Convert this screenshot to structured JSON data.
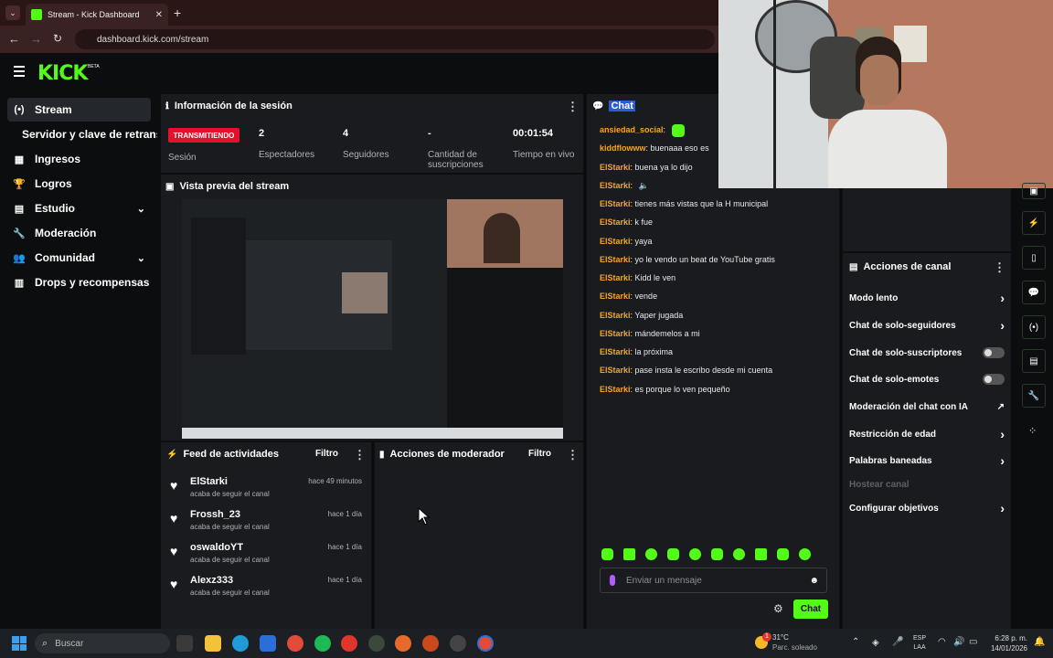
{
  "browser": {
    "tab_title": "Stream - Kick Dashboard",
    "url": "dashboard.kick.com/stream"
  },
  "brand": {
    "logo": "KICK",
    "beta": "BETA",
    "accent": "#53fc18"
  },
  "sidebar": {
    "items": [
      {
        "label": "Stream",
        "icon": "broadcast-icon"
      },
      {
        "label": "Servidor y clave de retransmisión",
        "icon": ""
      },
      {
        "label": "Ingresos",
        "icon": "chart-icon"
      },
      {
        "label": "Logros",
        "icon": "trophy-icon"
      },
      {
        "label": "Estudio",
        "icon": "grid-icon"
      },
      {
        "label": "Moderación",
        "icon": "wrench-icon"
      },
      {
        "label": "Comunidad",
        "icon": "people-icon"
      },
      {
        "label": "Drops y recompensas",
        "icon": "gift-icon"
      }
    ]
  },
  "session": {
    "title": "Información de la sesión",
    "badge": "TRANSMITIENDO",
    "badge_label": "Sesión",
    "stats": [
      {
        "value": "2",
        "label": "Espectadores"
      },
      {
        "value": "4",
        "label": "Seguidores"
      },
      {
        "value": "-",
        "label": "Cantidad de suscripciones"
      },
      {
        "value": "00:01:54",
        "label": "Tiempo en vivo"
      }
    ]
  },
  "preview": {
    "title": "Vista previa del stream"
  },
  "feed": {
    "title": "Feed de actividades",
    "filter": "Filtro",
    "items": [
      {
        "name": "ElStarki",
        "sub": "acaba de seguir el canal",
        "time": "hace 49 minutos"
      },
      {
        "name": "Frossh_23",
        "sub": "acaba de seguir el canal",
        "time": "hace 1 día"
      },
      {
        "name": "oswaldoYT",
        "sub": "acaba de seguir el canal",
        "time": "hace 1 día"
      },
      {
        "name": "Alexz333",
        "sub": "acaba de seguir el canal",
        "time": "hace 1 día"
      }
    ]
  },
  "mod_actions": {
    "title": "Acciones de moderador",
    "filter": "Filtro"
  },
  "chat": {
    "title": "Chat",
    "messages": [
      {
        "user": "ansiedad_social",
        "text": ""
      },
      {
        "user": "kiddflowww",
        "text": "buenaaa eso es"
      },
      {
        "user": "ElStarki",
        "text": "buena ya lo dijo"
      },
      {
        "user": "ElStarki",
        "text": ""
      },
      {
        "user": "ElStarki",
        "text": "tienes más vistas que la H municipal"
      },
      {
        "user": "ElStarki",
        "text": "k fue"
      },
      {
        "user": "ElStarki",
        "text": "yaya"
      },
      {
        "user": "ElStarki",
        "text": "yo le vendo un beat de YouTube gratis"
      },
      {
        "user": "ElStarki",
        "text": "Kidd le ven"
      },
      {
        "user": "ElStarki",
        "text": "vende"
      },
      {
        "user": "ElStarki",
        "text": "Yaper jugada"
      },
      {
        "user": "ElStarki",
        "text": "mándemelos a mi"
      },
      {
        "user": "ElStarki",
        "text": "la próxima"
      },
      {
        "user": "ElStarki",
        "text": "pase insta le escribo desde mi cuenta"
      },
      {
        "user": "ElStarki",
        "text": "es porque lo ven pequeño"
      }
    ],
    "placeholder": "Enviar un mensaje",
    "send": "Chat"
  },
  "channel_actions": {
    "title": "Acciones de canal",
    "items": [
      {
        "label": "Modo lento",
        "control": "arrow"
      },
      {
        "label": "Chat de solo-seguidores",
        "control": "arrow"
      },
      {
        "label": "Chat de solo-suscriptores",
        "control": "toggle"
      },
      {
        "label": "Chat de solo-emotes",
        "control": "toggle"
      },
      {
        "label": "Moderación del chat con IA",
        "control": "external"
      },
      {
        "label": "Restricción de edad",
        "control": "arrow"
      },
      {
        "label": "Palabras baneadas",
        "control": "arrow"
      },
      {
        "label": "Hostear canal",
        "control": "none"
      },
      {
        "label": "Configurar objetivos",
        "control": "arrow"
      }
    ]
  },
  "taskbar": {
    "search": "Buscar",
    "weather_temp": "31°C",
    "weather_desc": "Parc. soleado",
    "lang1": "ESP",
    "lang2": "LAA",
    "time": "6:28 p. m.",
    "date": "14/01/2026",
    "notif_count": "1"
  }
}
